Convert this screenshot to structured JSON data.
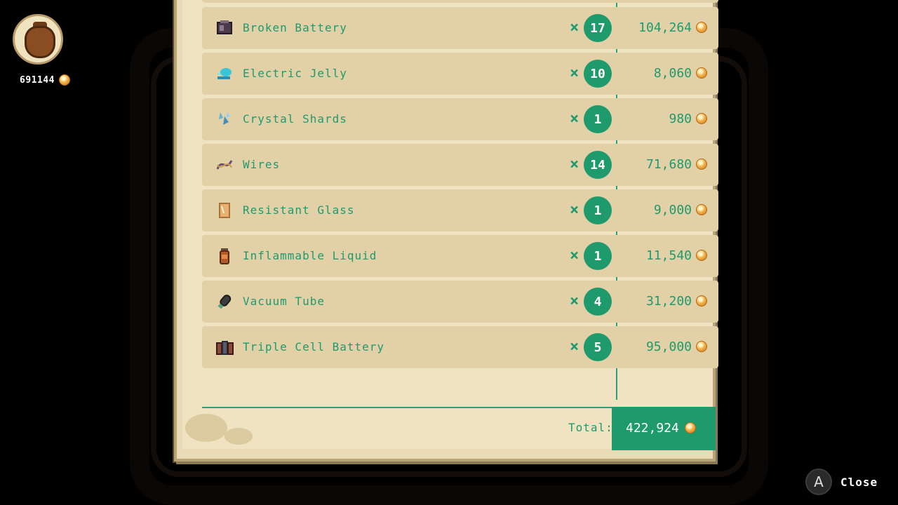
{
  "wallet": {
    "amount": "691144",
    "icon": "money-bag-icon"
  },
  "items": [
    {
      "name": "Broken Battery",
      "quantity": "17",
      "price": "104,264",
      "icon": "broken-battery-icon"
    },
    {
      "name": "Electric Jelly",
      "quantity": "10",
      "price": "8,060",
      "icon": "electric-jelly-icon"
    },
    {
      "name": "Crystal Shards",
      "quantity": "1",
      "price": "980",
      "icon": "crystal-shards-icon"
    },
    {
      "name": "Wires",
      "quantity": "14",
      "price": "71,680",
      "icon": "wires-icon"
    },
    {
      "name": "Resistant Glass",
      "quantity": "1",
      "price": "9,000",
      "icon": "resistant-glass-icon"
    },
    {
      "name": "Inflammable Liquid",
      "quantity": "1",
      "price": "11,540",
      "icon": "inflammable-liquid-icon"
    },
    {
      "name": "Vacuum Tube",
      "quantity": "4",
      "price": "31,200",
      "icon": "vacuum-tube-icon"
    },
    {
      "name": "Triple Cell Battery",
      "quantity": "5",
      "price": "95,000",
      "icon": "triple-cell-battery-icon"
    }
  ],
  "multiply_symbol": "×",
  "total": {
    "label": "Total:",
    "value": "422,924"
  },
  "close": {
    "button_glyph": "A",
    "label": "Close"
  },
  "colors": {
    "accent": "#1e9a6c",
    "parchment": "#efe3c2",
    "row": "#e2d1a7"
  }
}
